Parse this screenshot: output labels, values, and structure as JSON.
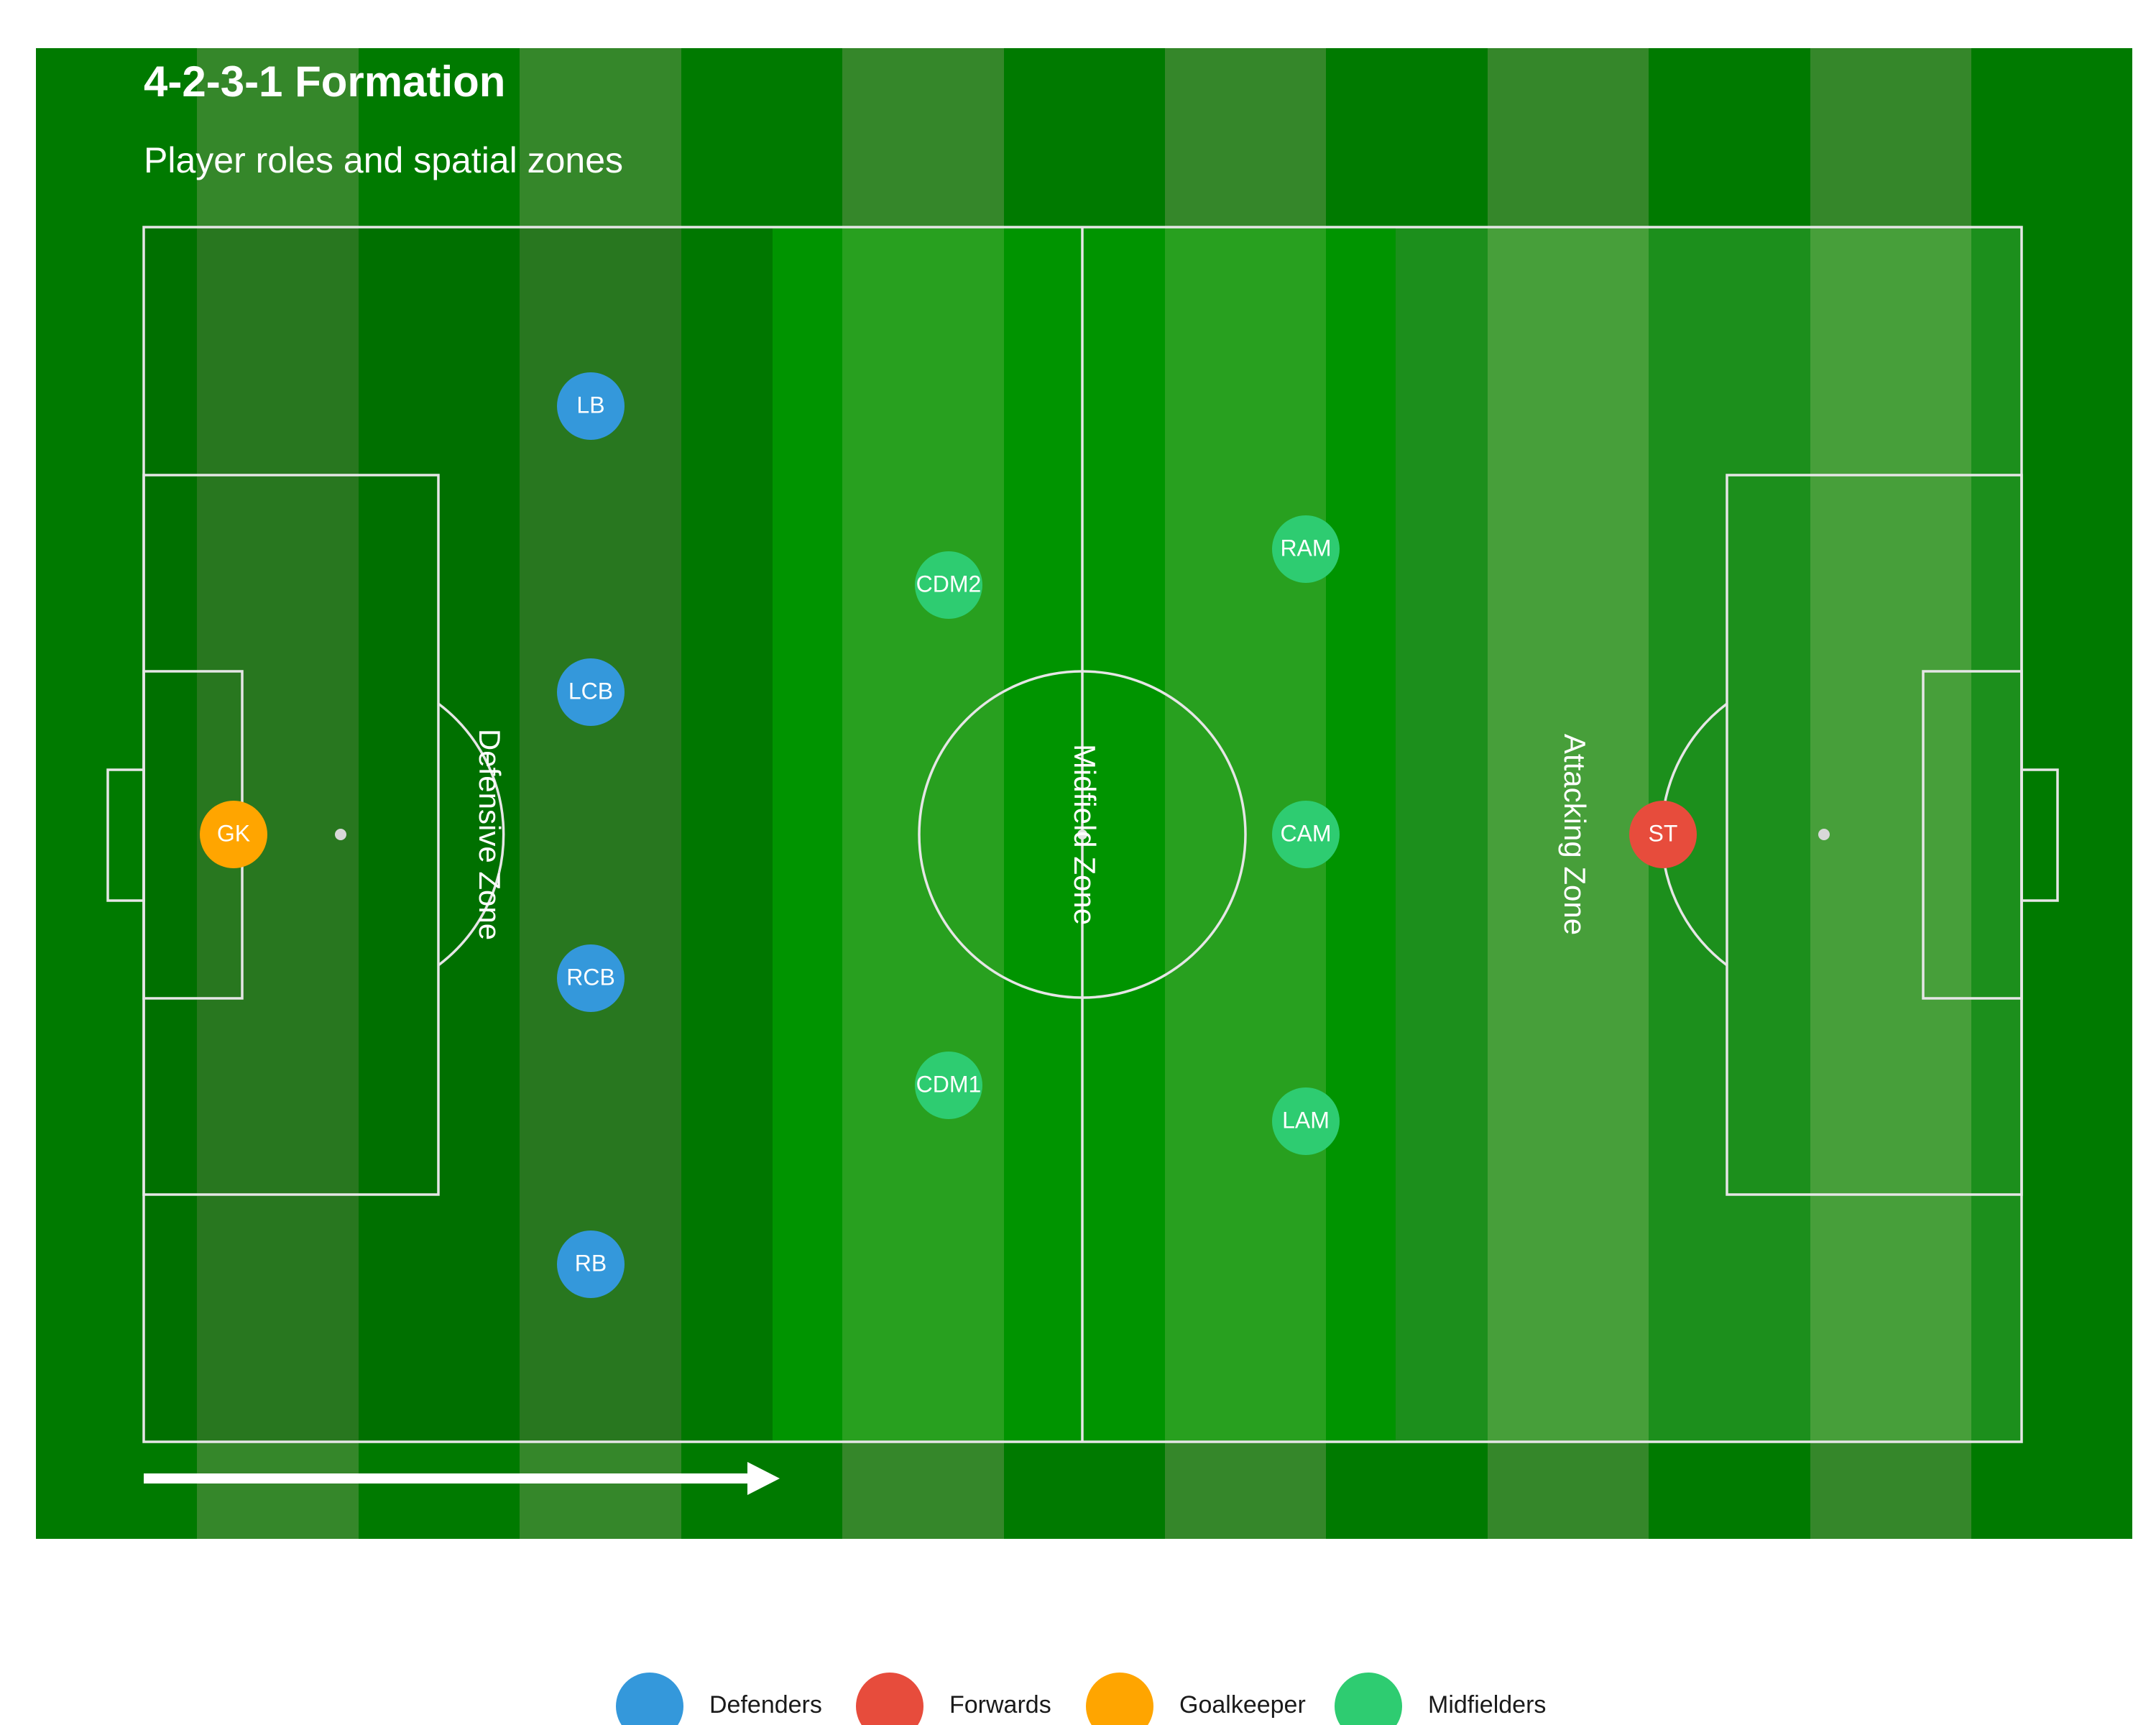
{
  "title": "4-2-3-1 Formation",
  "subtitle": "Player roles and spatial zones",
  "zones": [
    {
      "key": "defensive",
      "label": "Defensive Zone"
    },
    {
      "key": "midfield",
      "label": "Midfield Zone"
    },
    {
      "key": "attacking",
      "label": "Attacking Zone"
    }
  ],
  "players": [
    {
      "role": "GK",
      "group": "Goalkeeper"
    },
    {
      "role": "LB",
      "group": "Defenders"
    },
    {
      "role": "LCB",
      "group": "Defenders"
    },
    {
      "role": "RCB",
      "group": "Defenders"
    },
    {
      "role": "RB",
      "group": "Defenders"
    },
    {
      "role": "CDM2",
      "group": "Midfielders"
    },
    {
      "role": "CDM1",
      "group": "Midfielders"
    },
    {
      "role": "RAM",
      "group": "Midfielders"
    },
    {
      "role": "CAM",
      "group": "Midfielders"
    },
    {
      "role": "LAM",
      "group": "Midfielders"
    },
    {
      "role": "ST",
      "group": "Forwards"
    }
  ],
  "legend": [
    {
      "label": "Defenders",
      "color": "#3498db"
    },
    {
      "label": "Forwards",
      "color": "#e74c3c"
    },
    {
      "label": "Goalkeeper",
      "color": "#ffa500"
    },
    {
      "label": "Midfielders",
      "color": "#2ecc71"
    }
  ],
  "colors": {
    "pitch_dark": "#007a00",
    "pitch_light": "#35872a",
    "line": "#e8e8e8",
    "text": "#ffffff"
  },
  "direction_of_play": "left-to-right"
}
